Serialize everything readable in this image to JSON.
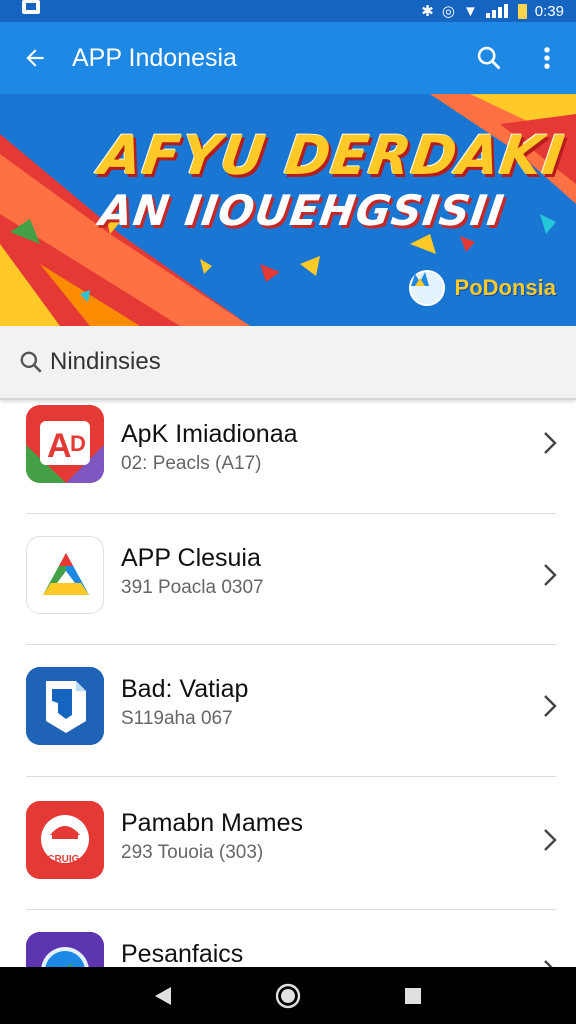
{
  "status_bar": {
    "time": "0:39"
  },
  "app_bar": {
    "title": "APP Indonesia"
  },
  "banner": {
    "line1": "AFYU DERDAKI",
    "line2": "AN IIOUEHGSISII",
    "brand_name": "PoDonsia"
  },
  "search": {
    "value": "Nindinsies"
  },
  "apps": [
    {
      "name": "ApK Imiadionaa",
      "meta": "02: Peacls (A17)",
      "icon": "apk-app-icon",
      "color": "#e53935"
    },
    {
      "name": "APP Clesuia",
      "meta": "391 Poacla 0307",
      "icon": "triangle-app-icon",
      "color": "#ffffff"
    },
    {
      "name": "Bad: Vatiap",
      "meta": "S119aha 067",
      "icon": "document-app-icon",
      "color": "#1565c0"
    },
    {
      "name": "Pamabn Mames",
      "meta": "293 Touoia (303)",
      "icon": "cap-app-icon",
      "color": "#e53935"
    },
    {
      "name": "Pesanfaics",
      "meta": "",
      "icon": "compass-app-icon",
      "color": "#5e35b1"
    }
  ],
  "colors": {
    "primary": "#1e88e5",
    "status": "#1565c0",
    "accent": "#ffca28"
  }
}
